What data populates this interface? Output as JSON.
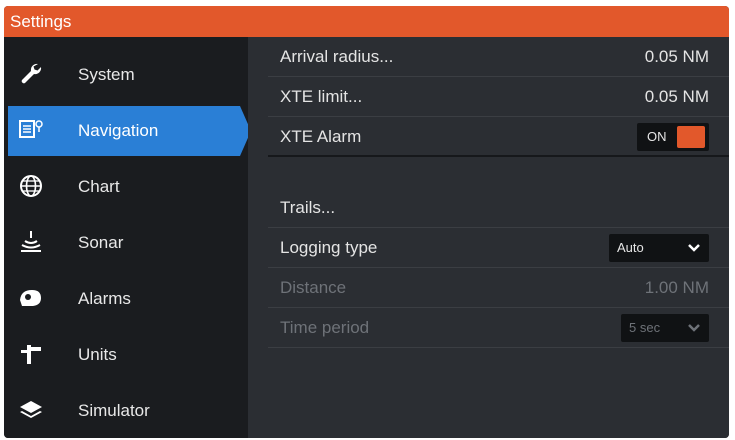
{
  "window": {
    "title": "Settings"
  },
  "sidebar": {
    "items": [
      {
        "label": "System",
        "icon": "wrench-icon"
      },
      {
        "label": "Navigation",
        "icon": "navigation-icon",
        "active": true
      },
      {
        "label": "Chart",
        "icon": "globe-icon"
      },
      {
        "label": "Sonar",
        "icon": "sonar-icon"
      },
      {
        "label": "Alarms",
        "icon": "alarm-bell-icon"
      },
      {
        "label": "Units",
        "icon": "units-icon"
      },
      {
        "label": "Simulator",
        "icon": "layers-icon"
      }
    ]
  },
  "settings": {
    "arrival_radius": {
      "label": "Arrival radius...",
      "value": "0.05 NM"
    },
    "xte_limit": {
      "label": "XTE limit...",
      "value": "0.05 NM"
    },
    "xte_alarm": {
      "label": "XTE Alarm",
      "toggle_text": "ON"
    },
    "trails": {
      "label": "Trails..."
    },
    "logging_type": {
      "label": "Logging type",
      "selected": "Auto"
    },
    "distance": {
      "label": "Distance",
      "value": "1.00 NM"
    },
    "time_period": {
      "label": "Time period",
      "selected": "5 sec"
    }
  },
  "colors": {
    "accent": "#e2582b",
    "active_item": "#2a7fd6"
  }
}
